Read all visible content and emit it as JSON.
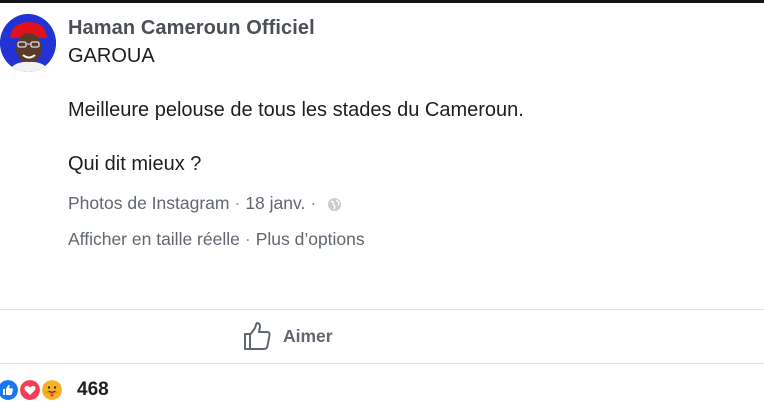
{
  "post": {
    "author": "Haman Cameroun Officiel",
    "lines": [
      "GAROUA",
      "Meilleure pelouse de tous les stades du Cameroun.",
      "Qui dit mieux ?"
    ],
    "source": "Photos de Instagram",
    "date": "18 janv.",
    "separator": "·",
    "privacy_icon": "globe-icon",
    "links": {
      "full_size": "Afficher en taille réelle",
      "more_options": "Plus d’options"
    }
  },
  "actions": {
    "like_label": "Aimer",
    "like_icon": "thumbs-up-icon"
  },
  "reactions": {
    "icons": [
      "like-reaction-icon",
      "love-reaction-icon",
      "care-reaction-icon"
    ],
    "count": "468"
  },
  "colors": {
    "author": "#4b4f56",
    "meta": "#606770",
    "like_blue": "#1877f2",
    "love_red": "#f33e58",
    "care_yellow": "#f7b125"
  }
}
